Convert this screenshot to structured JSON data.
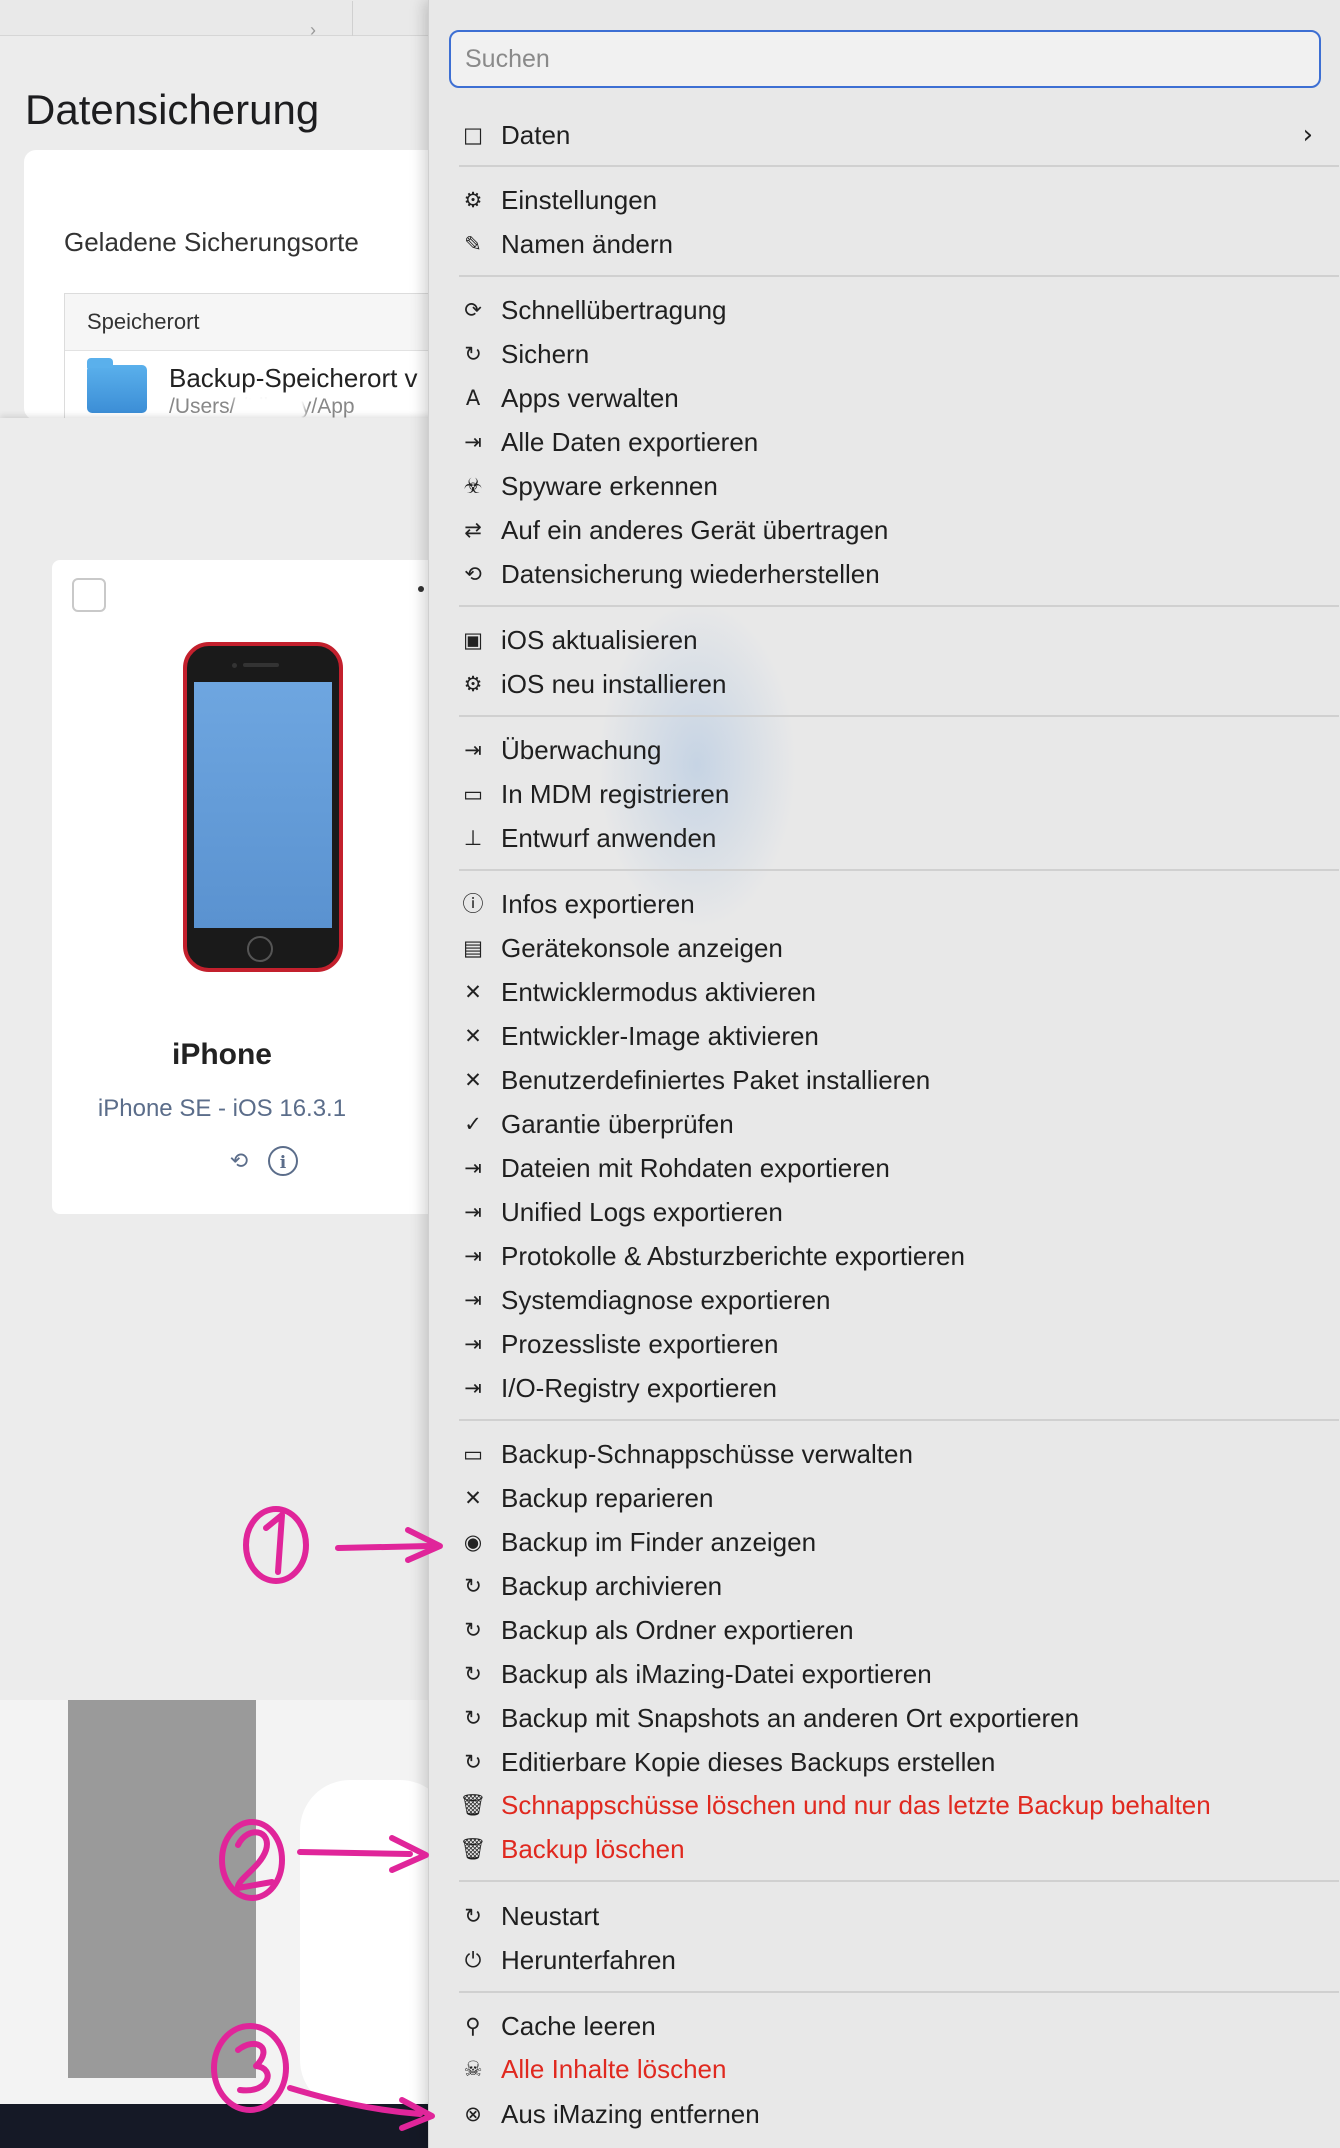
{
  "background": {
    "page_title": "Datensicherung",
    "locations_card": {
      "title": "Geladene Sicherungsorte",
      "column_header": "Speicherort",
      "row": {
        "name": "Backup-Speicherort v",
        "path": "/Users/         /Library/App"
      }
    },
    "device": {
      "name": "iPhone",
      "model": "iPhone SE - iOS 16.3.1",
      "backup_icon": "backup-icon",
      "info_icon": "i"
    }
  },
  "menu": {
    "search_placeholder": "Suchen",
    "submenu_arrow": "›",
    "items": [
      {
        "icon": "□",
        "label": "Daten"
      },
      {
        "icon": "⚙",
        "label": "Einstellungen"
      },
      {
        "icon": "✎",
        "label": "Namen ändern"
      },
      {
        "icon": "⟳",
        "label": "Schnellübertragung"
      },
      {
        "icon": "↻",
        "label": "Sichern"
      },
      {
        "icon": "A",
        "label": "Apps verwalten"
      },
      {
        "icon": "⇥",
        "label": "Alle Daten exportieren"
      },
      {
        "icon": "☣",
        "label": "Spyware erkennen"
      },
      {
        "icon": "⇄",
        "label": "Auf ein anderes Gerät übertragen"
      },
      {
        "icon": "⟲",
        "label": "Datensicherung wiederherstellen"
      },
      {
        "icon": "▣",
        "label": "iOS aktualisieren"
      },
      {
        "icon": "⚙",
        "label": "iOS neu installieren"
      },
      {
        "icon": "⇥",
        "label": "Überwachung"
      },
      {
        "icon": "▭",
        "label": "In MDM registrieren"
      },
      {
        "icon": "⊥",
        "label": "Entwurf anwenden"
      },
      {
        "icon": "ⓘ",
        "label": "Infos exportieren"
      },
      {
        "icon": "▤",
        "label": "Gerätekonsole anzeigen"
      },
      {
        "icon": "✕",
        "label": "Entwicklermodus aktivieren"
      },
      {
        "icon": "✕",
        "label": "Entwickler-Image aktivieren"
      },
      {
        "icon": "✕",
        "label": "Benutzerdefiniertes Paket installieren"
      },
      {
        "icon": "✓",
        "label": "Garantie überprüfen"
      },
      {
        "icon": "⇥",
        "label": "Dateien mit Rohdaten exportieren"
      },
      {
        "icon": "⇥",
        "label": "Unified Logs exportieren"
      },
      {
        "icon": "⇥",
        "label": "Protokolle & Absturzberichte exportieren"
      },
      {
        "icon": "⇥",
        "label": "Systemdiagnose exportieren"
      },
      {
        "icon": "⇥",
        "label": "Prozessliste exportieren"
      },
      {
        "icon": "⇥",
        "label": "I/O-Registry exportieren"
      },
      {
        "icon": "▭",
        "label": "Backup-Schnappschüsse verwalten"
      },
      {
        "icon": "✕",
        "label": "Backup reparieren"
      },
      {
        "icon": "◉",
        "label": "Backup im Finder anzeigen"
      },
      {
        "icon": "↻",
        "label": "Backup archivieren"
      },
      {
        "icon": "↻",
        "label": "Backup als Ordner exportieren"
      },
      {
        "icon": "↻",
        "label": "Backup als iMazing-Datei exportieren"
      },
      {
        "icon": "↻",
        "label": "Backup mit Snapshots an anderen Ort exportieren"
      },
      {
        "icon": "↻",
        "label": "Editierbare Kopie dieses Backups erstellen"
      },
      {
        "icon": "🗑",
        "label": "Schnappschüsse löschen und nur das letzte Backup behalten"
      },
      {
        "icon": "🗑",
        "label": "Backup löschen"
      },
      {
        "icon": "↻",
        "label": "Neustart"
      },
      {
        "icon": "⏻",
        "label": "Herunterfahren"
      },
      {
        "icon": "⚲",
        "label": "Cache leeren"
      },
      {
        "icon": "☠",
        "label": "Alle Inhalte löschen"
      },
      {
        "icon": "⊗",
        "label": "Aus iMazing entfernen"
      }
    ]
  },
  "annotations": [
    {
      "label": "1",
      "target": "Backup im Finder anzeigen"
    },
    {
      "label": "2",
      "target": "Backup löschen"
    },
    {
      "label": "3",
      "target": "Aus iMazing entfernen"
    }
  ],
  "colors": {
    "accent": "#3d6fd3",
    "destructive": "#e0291f",
    "annotation": "#e0259a",
    "device_red": "#c3202d"
  }
}
